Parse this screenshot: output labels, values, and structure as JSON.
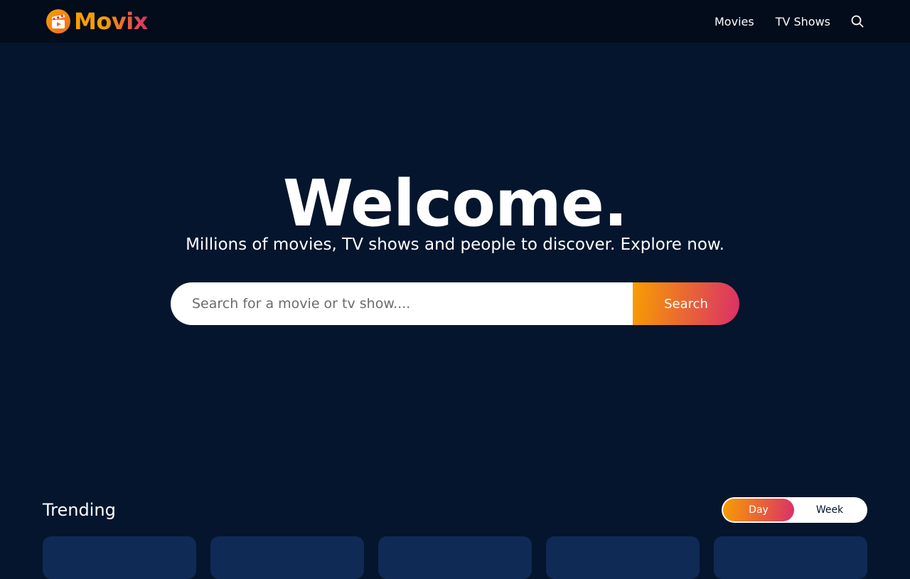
{
  "brand": {
    "name": "Movix",
    "accent_start": "#f89e00",
    "accent_end": "#da2f68",
    "icon": "clapperboard-play-logo-icon"
  },
  "colors": {
    "page_bg": "#04152d",
    "header_bg": "#020c1b",
    "card_bg": "#0f2a55"
  },
  "nav": {
    "items": [
      {
        "label": "Movies"
      },
      {
        "label": "TV Shows"
      }
    ],
    "search_icon": "search-icon"
  },
  "hero": {
    "title": "Welcome.",
    "subtitle": "Millions of movies, TV shows and people to discover. Explore now.",
    "search": {
      "placeholder": "Search for a movie or tv show....",
      "value": "",
      "button_label": "Search"
    }
  },
  "trending": {
    "title": "Trending",
    "tabs": [
      {
        "label": "Day",
        "active": true
      },
      {
        "label": "Week",
        "active": false
      }
    ],
    "card_count": 5
  }
}
